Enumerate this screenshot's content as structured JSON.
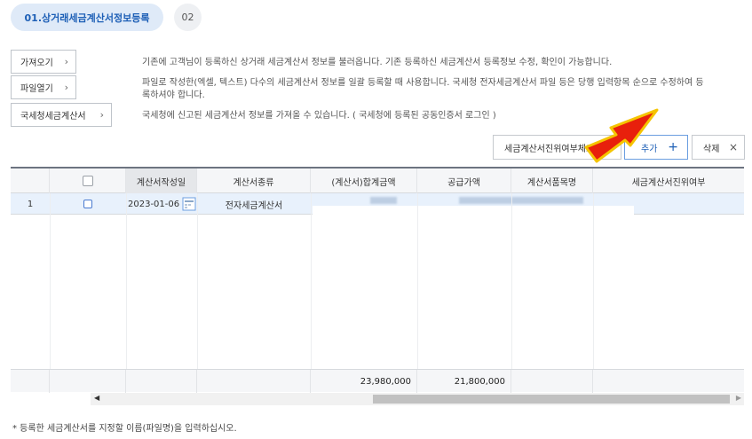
{
  "steps": {
    "step1": "01.상거래세금계산서정보등록",
    "step2": "02"
  },
  "left_buttons": {
    "fetch": "가져오기",
    "open_file": "파일열기",
    "nts_invoice": "국세청세금계산서"
  },
  "chevron": "›",
  "descriptions": {
    "fetch": "기존에 고객님이 등록하신 상거래 세금계산서 정보를 불러옵니다. 기존 등록하신 세금계산서 등록정보 수정, 확인이 가능합니다.",
    "open_file_line1": "파일로 작성한(엑셀, 텍스트) 다수의 세금계산서 정보를 일괄 등록할 때 사용합니다. 국세청 전자세금계산서 파일 등은 당행 입력항목 순으로 수정하여 등",
    "open_file_line2": "록하셔야 합니다.",
    "nts": "국세청에 신고된 세금계산서 정보를 가져올 수 있습니다. ( 국세청에 등록된 공동인증서 로그인 )"
  },
  "actions": {
    "verify": "세금계산서진위여부체크",
    "add": "추가",
    "add_icon": "+",
    "delete": "삭제",
    "delete_icon": "×"
  },
  "table": {
    "headers": [
      "",
      "",
      "계산서작성일",
      "계산서종류",
      "(계산서)합계금액",
      "공급가액",
      "계산서품목명",
      "세금계산서진위여부"
    ],
    "rows": [
      {
        "no": "1",
        "date": "2023-01-06",
        "type": "전자세금계산서"
      }
    ],
    "totals": {
      "total_amount": "23,980,000",
      "supply_amount": "21,800,000"
    }
  },
  "scroll": {
    "left_arrow": "◀",
    "right_arrow": "▶"
  },
  "footnote": "* 등록한 세금계산서를 지정할 이름(파일명)을 입력하십시오.",
  "colors": {
    "accent": "#1d5fb6",
    "arrow_fill": "#e8200c",
    "arrow_outline": "#f5c400"
  }
}
